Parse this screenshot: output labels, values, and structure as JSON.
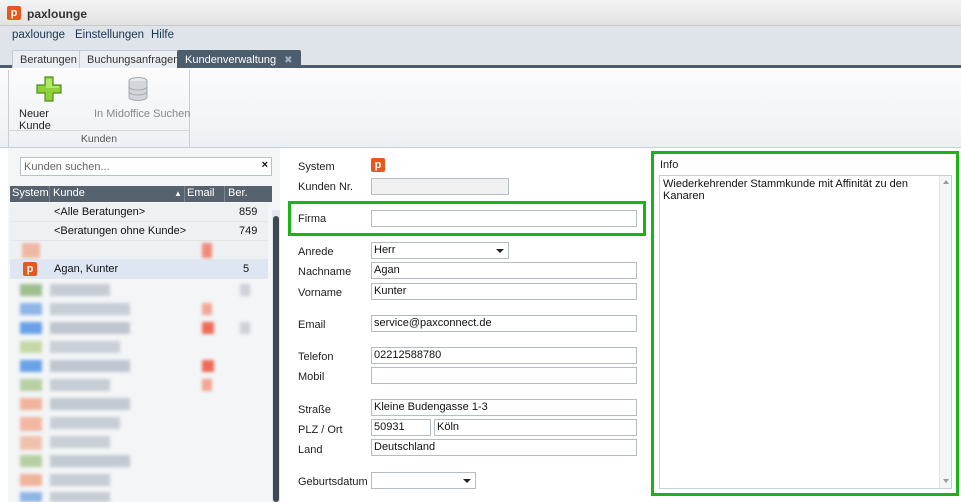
{
  "app": {
    "title": "paxlounge",
    "logo_letter": "p"
  },
  "menu": {
    "items": [
      "paxlounge",
      "Einstellungen",
      "Hilfe"
    ]
  },
  "tabs": [
    {
      "label": "Beratungen"
    },
    {
      "label": "Buchungsanfragen"
    },
    {
      "label": "Kundenverwaltung",
      "active": true
    }
  ],
  "ribbon": {
    "new_customer_label": "Neuer Kunde",
    "midoffice_search_label": "In Midoffice Suchen",
    "group_label": "Kunden"
  },
  "customer_list": {
    "search_placeholder": "Kunden suchen...",
    "clear_symbol": "×",
    "columns": {
      "system": "System",
      "kunde": "Kunde",
      "email": "Email",
      "ber": "Ber."
    },
    "rows": [
      {
        "kunde": "<Alle Beratungen>",
        "ber": "859"
      },
      {
        "kunde": "<Beratungen ohne Kunde>",
        "ber": "749"
      },
      {
        "kunde": "Agan, Kunter",
        "ber": "5",
        "system_icon": "p"
      }
    ]
  },
  "form": {
    "system_label": "System",
    "kunden_nr_label": "Kunden Nr.",
    "kunden_nr_value": "",
    "firma_label": "Firma",
    "firma_value": "",
    "anrede_label": "Anrede",
    "anrede_value": "Herr",
    "nachname_label": "Nachname",
    "nachname_value": "Agan",
    "vorname_label": "Vorname",
    "vorname_value": "Kunter",
    "email_label": "Email",
    "email_value": "service@paxconnect.de",
    "telefon_label": "Telefon",
    "telefon_value": "02212588780",
    "mobil_label": "Mobil",
    "mobil_value": "",
    "strasse_label": "Straße",
    "strasse_value": "Kleine Budengasse 1-3",
    "plz_ort_label": "PLZ / Ort",
    "plz_value": "50931",
    "ort_value": "Köln",
    "land_label": "Land",
    "land_value": "Deutschland",
    "geburtsdatum_label": "Geburtsdatum",
    "geburtsdatum_value": ""
  },
  "info": {
    "label": "Info",
    "text": "Wiederkehrender Stammkunde mit Affinität zu den Kanaren"
  },
  "colors": {
    "highlight": "#18b418",
    "brand": "#e8581c",
    "tab_active": "#4e5d6c"
  }
}
